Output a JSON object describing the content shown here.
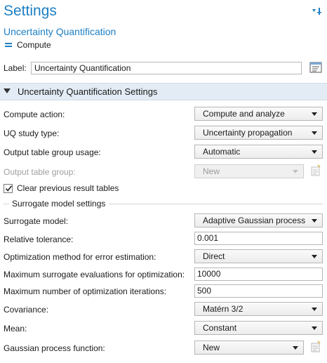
{
  "header": {
    "title": "Settings",
    "subtitle": "Uncertainty Quantification",
    "compute_label": "Compute"
  },
  "label_row": {
    "label": "Label:",
    "value": "Uncertainty Quantification"
  },
  "section": {
    "title": "Uncertainty Quantification Settings"
  },
  "fields": {
    "compute_action": {
      "label": "Compute action:",
      "value": "Compute and analyze"
    },
    "uq_study_type": {
      "label": "UQ study type:",
      "value": "Uncertainty propagation"
    },
    "output_table_group_usage": {
      "label": "Output table group usage:",
      "value": "Automatic"
    },
    "output_table_group": {
      "label": "Output table group:",
      "value": "New"
    },
    "clear_previous": {
      "label": "Clear previous result tables",
      "checked": true
    },
    "surrogate_group": {
      "label": "Surrogate model settings"
    },
    "surrogate_model": {
      "label": "Surrogate model:",
      "value": "Adaptive Gaussian process"
    },
    "relative_tolerance": {
      "label": "Relative tolerance:",
      "value": "0.001"
    },
    "optimization_method": {
      "label": "Optimization method for error estimation:",
      "value": "Direct"
    },
    "max_surrogate_evals": {
      "label": "Maximum surrogate evaluations for optimization:",
      "value": "10000"
    },
    "max_opt_iterations": {
      "label": "Maximum number of optimization iterations:",
      "value": "500"
    },
    "covariance": {
      "label": "Covariance:",
      "value": "Matérn 3/2"
    },
    "mean": {
      "label": "Mean:",
      "value": "Constant"
    },
    "gp_function": {
      "label": "Gaussian process function:",
      "value": "New"
    }
  },
  "colors": {
    "accent": "#1c7fc4",
    "section_bg": "#e3ecf5"
  }
}
